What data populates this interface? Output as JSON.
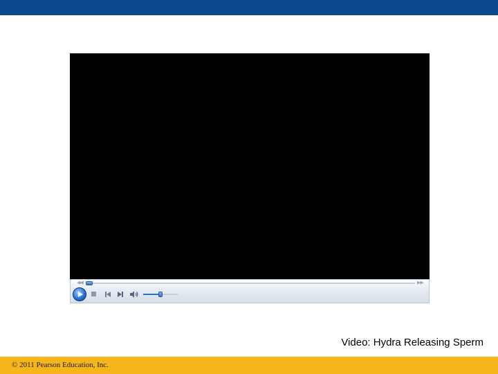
{
  "slide": {
    "caption": "Video: Hydra Releasing Sperm",
    "copyright": "© 2011 Pearson Education, Inc.",
    "colors": {
      "top_bar": "#0a4a8c",
      "bottom_bar": "#f6b51a",
      "video": "#000000"
    }
  },
  "player": {
    "seek_progress": 0.0,
    "volume_level": 0.5,
    "icons": [
      "rewind-icon",
      "fast-forward-icon",
      "play-icon",
      "stop-icon",
      "previous-icon",
      "next-icon",
      "volume-icon"
    ]
  }
}
